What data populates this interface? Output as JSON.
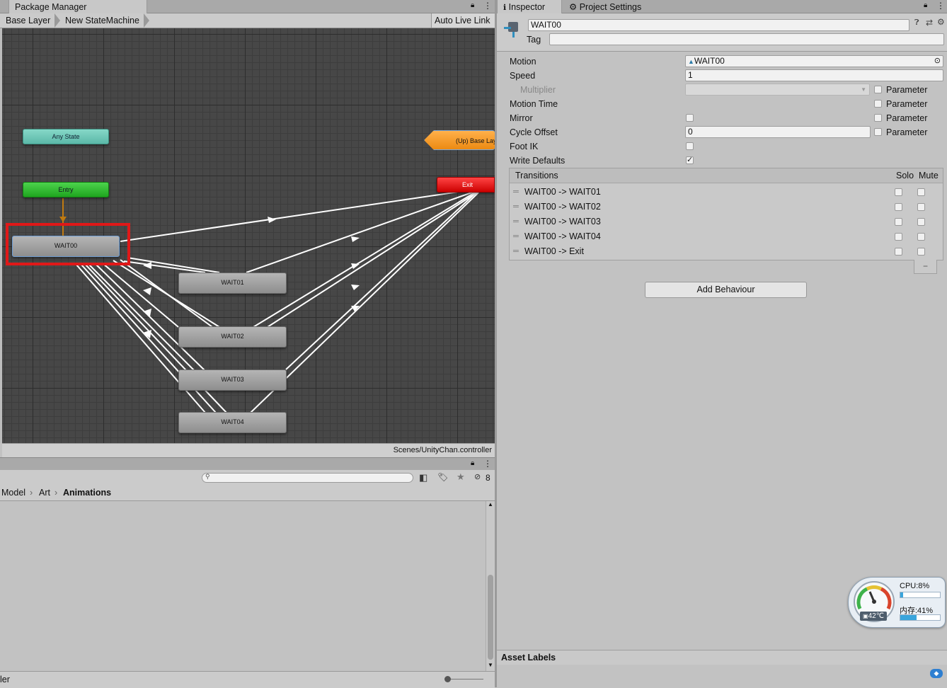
{
  "left_tabs": {
    "package_manager": "Package Manager"
  },
  "breadcrumb": {
    "base_layer": "Base Layer",
    "state_machine": "New StateMachine"
  },
  "auto_live_link": "Auto Live Link",
  "graph": {
    "nodes": {
      "any_state": "Any State",
      "entry": "Entry",
      "exit": "Exit",
      "up_base": "(Up) Base Lay",
      "wait00": "WAIT00",
      "wait01": "WAIT01",
      "wait02": "WAIT02",
      "wait03": "WAIT03",
      "wait04": "WAIT04"
    },
    "status_path": "Scenes/UnityChan.controller"
  },
  "project": {
    "search_placeholder": "",
    "hidden_count": "8",
    "path": [
      "Model",
      "Art",
      "Animations"
    ],
    "footer_label": "ler"
  },
  "inspector": {
    "tab_inspector": "Inspector",
    "tab_project_settings": "Project Settings",
    "state_name": "WAIT00",
    "tag_label": "Tag",
    "tag_value": "",
    "motion_label": "Motion",
    "motion_value": "WAIT00",
    "speed_label": "Speed",
    "speed_value": "1",
    "multiplier_label": "Multiplier",
    "motion_time_label": "Motion Time",
    "mirror_label": "Mirror",
    "cycle_offset_label": "Cycle Offset",
    "cycle_offset_value": "0",
    "foot_ik_label": "Foot IK",
    "write_defaults_label": "Write Defaults",
    "write_defaults_checked": true,
    "parameter_label": "Parameter",
    "transitions_header": "Transitions",
    "solo_label": "Solo",
    "mute_label": "Mute",
    "transitions": [
      "WAIT00 -> WAIT01",
      "WAIT00 -> WAIT02",
      "WAIT00 -> WAIT03",
      "WAIT00 -> WAIT04",
      "WAIT00 -> Exit"
    ],
    "remove_button": "−",
    "add_behaviour": "Add Behaviour",
    "asset_labels": "Asset Labels"
  },
  "monitor": {
    "cpu": "CPU:8%",
    "cpu_fraction": 0.08,
    "memory": "内存:41%",
    "memory_fraction": 0.41,
    "temperature": "42℃"
  }
}
